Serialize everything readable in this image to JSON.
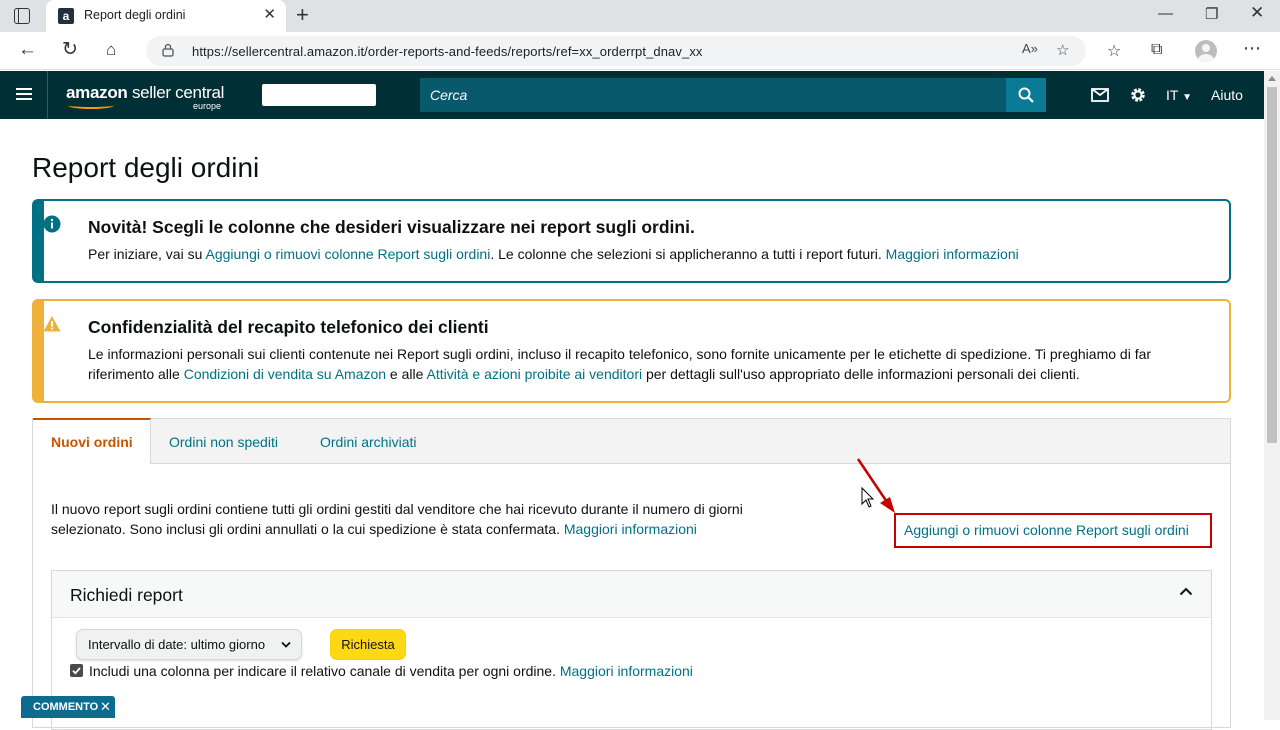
{
  "browser": {
    "tab_title": "Report degli ordini",
    "favicon": "a",
    "url": "https://sellercentral.amazon.it/order-reports-and-feeds/reports/ref=xx_orderrpt_dnav_xx"
  },
  "header": {
    "logo_brand": "amazon",
    "logo_product": "seller central",
    "logo_region": "europe",
    "search_placeholder": "Cerca",
    "language": "IT",
    "help": "Aiuto"
  },
  "page": {
    "title": "Report degli ordini"
  },
  "info_alert": {
    "title": "Novità! Scegli le colonne che desideri visualizzare nei report sugli ordini.",
    "body_prefix": "Per iniziare, vai su ",
    "body_link": "Aggiungi o rimuovi colonne Report sugli ordini",
    "body_middle": ". Le colonne che selezioni si applicheranno a tutti i report futuri. ",
    "body_more": "Maggiori informazioni"
  },
  "warning_alert": {
    "title": "Confidenzialità del recapito telefonico dei clienti",
    "body_1": "Le informazioni personali sui clienti contenute nei Report sugli ordini, incluso il recapito telefonico, sono fornite unicamente per le etichette di spedizione. Ti preghiamo di far riferimento alle ",
    "link_1": "Condizioni di vendita su Amazon",
    "body_2": " e alle ",
    "link_2": "Attività e azioni proibite ai venditori",
    "body_3": " per dettagli sull'uso appropriato delle informazioni personali dei clienti."
  },
  "tabs": [
    {
      "label": "Nuovi ordini",
      "active": true
    },
    {
      "label": "Ordini non spediti",
      "active": false
    },
    {
      "label": "Ordini archiviati",
      "active": false
    }
  ],
  "tab_content": {
    "description": "Il nuovo report sugli ordini contiene tutti gli ordini gestiti dal venditore che hai ricevuto durante il numero di giorni selezionato. Sono inclusi gli ordini annullati o la cui spedizione è stata confermata. ",
    "more_link": "Maggiori informazioni",
    "add_columns_link": "Aggiungi o rimuovi colonne Report sugli ordini"
  },
  "request": {
    "title": "Richiedi report",
    "date_range": "Intervallo di date: ultimo giorno",
    "submit": "Richiesta",
    "checkbox_checked": true,
    "checkbox_label": "Includi una colonna per indicare il relativo canale di vendita per ogni ordine. ",
    "checkbox_more": "Maggiori informazioni"
  },
  "comment_badge": "COMMENTO",
  "colors": {
    "header_bg": "#002f36",
    "link": "#007185",
    "active_tab": "#c45500",
    "info_border": "#007185",
    "warn_border": "#f0b13a",
    "primary_button": "#ffd814",
    "annotation": "#c40000"
  }
}
